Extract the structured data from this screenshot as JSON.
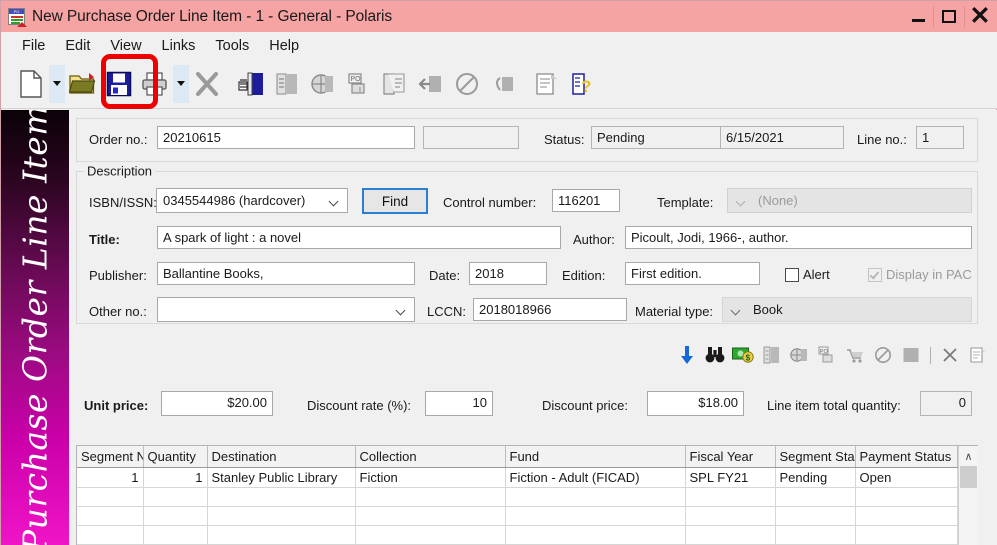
{
  "window": {
    "title": "New Purchase Order Line Item - 1 - General - Polaris",
    "icon": "po-document-icon",
    "titlebar_color": "#f5a3a3",
    "controls": {
      "minimize": "minimize-icon",
      "maximize": "maximize-icon",
      "close": "close-icon"
    }
  },
  "menu": {
    "items": [
      "File",
      "Edit",
      "View",
      "Links",
      "Tools",
      "Help"
    ]
  },
  "toolbar": {
    "annotation": {
      "type": "red-highlight-ring",
      "color": "#ee0000",
      "target": "save-button"
    },
    "buttons": [
      {
        "name": "new-icon",
        "label": "New"
      },
      {
        "name": "new-dropdown-arrow",
        "label": ""
      },
      {
        "name": "open-icon",
        "label": "Open"
      },
      {
        "name": "save-icon",
        "label": "Save"
      },
      {
        "name": "print-icon",
        "label": "Print"
      },
      {
        "name": "print-dropdown-arrow",
        "label": ""
      },
      {
        "name": "delete-icon",
        "label": "Delete"
      },
      {
        "name": "select-list-icon",
        "label": "Select List"
      },
      {
        "name": "item-record-icon",
        "label": "Item Record"
      },
      {
        "name": "bibliographic-record-icon",
        "label": "Bibliographic Record"
      },
      {
        "name": "purchase-order-icon",
        "label": "Purchase Order"
      },
      {
        "name": "invoice-icon",
        "label": "Invoice"
      },
      {
        "name": "receive-icon",
        "label": "Receive"
      },
      {
        "name": "cancel-icon",
        "label": "Cancel"
      },
      {
        "name": "claim-icon",
        "label": "Claim"
      },
      {
        "name": "notes-icon",
        "label": "Notes"
      },
      {
        "name": "help-icon",
        "label": "Help"
      }
    ]
  },
  "banner": {
    "text": "Purchase Order Line Item"
  },
  "header": {
    "order_no_label": "Order no.:",
    "order_no_value": "20210615",
    "order_no_secondary_value": "",
    "status_label": "Status:",
    "status_value": "Pending",
    "status_date": "6/15/2021",
    "line_no_label": "Line no.:",
    "line_no_value": "1"
  },
  "description": {
    "legend": "Description",
    "isbn_label": "ISBN/ISSN:",
    "isbn_value": "0345544986 (hardcover)",
    "find_button": "Find",
    "control_number_label": "Control number:",
    "control_number_value": "116201",
    "template_label": "Template:",
    "template_value": "(None)",
    "title_label": "Title:",
    "title_value": "A spark of light : a novel",
    "author_label": "Author:",
    "author_value": "Picoult, Jodi, 1966-, author.",
    "publisher_label": "Publisher:",
    "publisher_value": "Ballantine Books,",
    "date_label": "Date:",
    "date_value": "2018",
    "edition_label": "Edition:",
    "edition_value": "First edition.",
    "alert_label": "Alert",
    "alert_checked": false,
    "display_in_pac_label": "Display in PAC",
    "display_in_pac_checked": true,
    "other_no_label": "Other no.:",
    "other_no_value": "",
    "lccn_label": "LCCN:",
    "lccn_value": "2018018966",
    "material_type_label": "Material type:",
    "material_type_value": "Book"
  },
  "icon_strip": [
    {
      "name": "download-arrow-icon",
      "enabled": true
    },
    {
      "name": "binoculars-search-icon",
      "enabled": true
    },
    {
      "name": "money-funds-icon",
      "enabled": true
    },
    {
      "name": "item-record-icon",
      "enabled": false
    },
    {
      "name": "bibliographic-record-icon",
      "enabled": false
    },
    {
      "name": "purchase-order-icon",
      "enabled": false
    },
    {
      "name": "shopping-cart-icon",
      "enabled": false
    },
    {
      "name": "cancel-icon",
      "enabled": false
    },
    {
      "name": "block-icon",
      "enabled": false
    },
    {
      "name": "delete-x-icon",
      "enabled": false
    },
    {
      "name": "notes-icon",
      "enabled": false
    }
  ],
  "pricing": {
    "unit_price_label": "Unit price:",
    "unit_price_value": "$20.00",
    "discount_rate_label": "Discount rate (%):",
    "discount_rate_value": "10",
    "discount_price_label": "Discount price:",
    "discount_price_value": "$18.00",
    "line_item_total_quantity_label": "Line item total quantity:",
    "line_item_total_quantity_value": "0"
  },
  "grid": {
    "columns": [
      "Segment N",
      "Quantity",
      "Destination",
      "Collection",
      "Fund",
      "Fiscal Year",
      "Segment Sta",
      "Payment Status"
    ],
    "rows": [
      {
        "segment_no": "1",
        "quantity": "1",
        "destination": "Stanley Public Library",
        "collection": "Fiction",
        "fund": "Fiction - Adult (FICAD)",
        "fiscal_year": "SPL FY21",
        "segment_status": "Pending",
        "payment_status": "Open"
      }
    ],
    "empty_row_count": 3,
    "scroll_up": "∧"
  }
}
